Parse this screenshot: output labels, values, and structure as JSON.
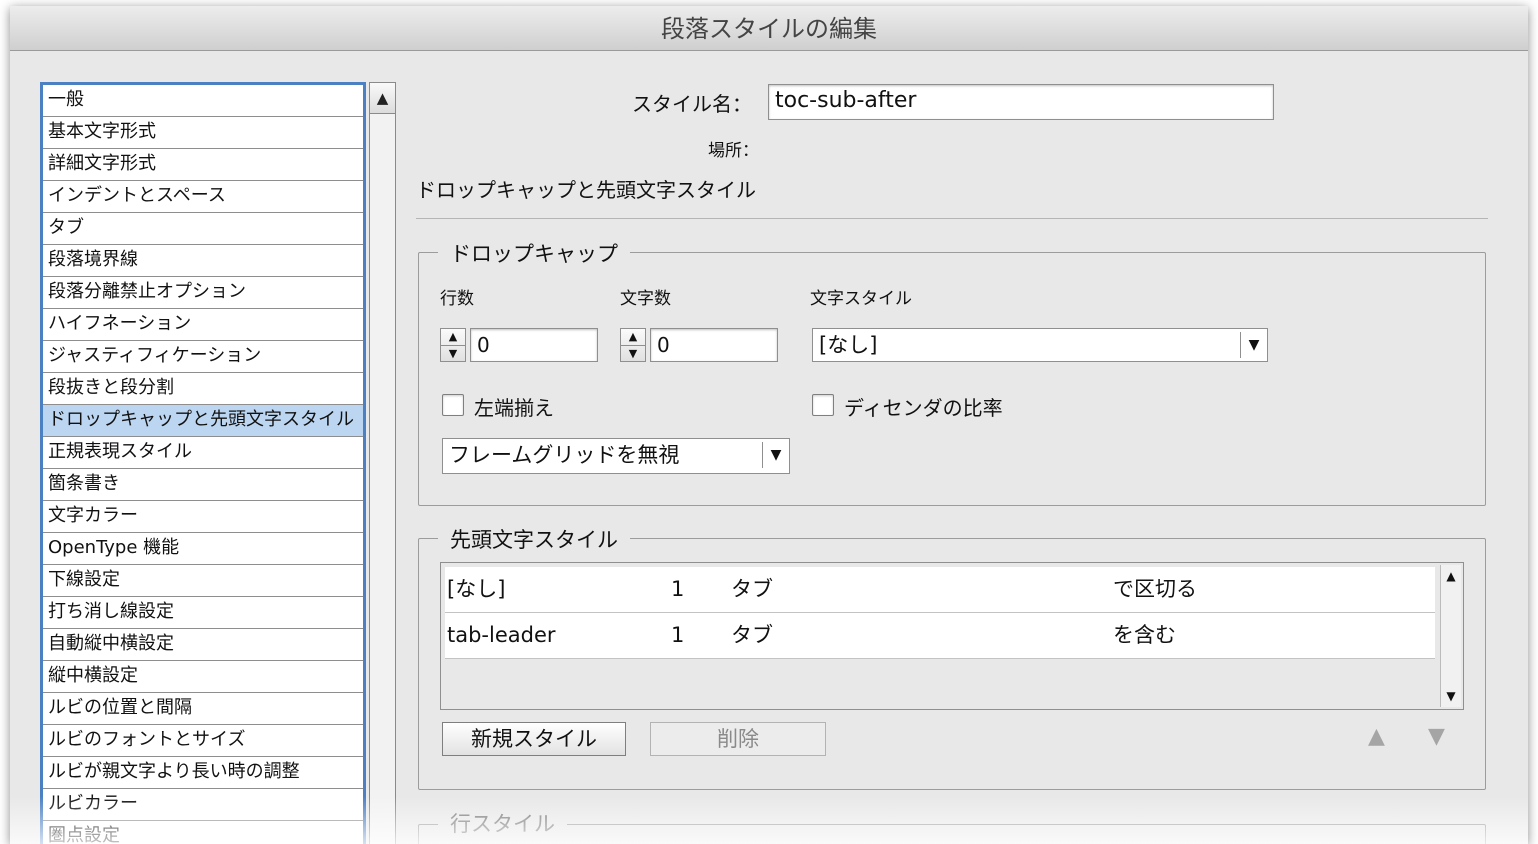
{
  "dialog": {
    "title": "段落スタイルの編集"
  },
  "sidebar": {
    "items": [
      "一般",
      "基本文字形式",
      "詳細文字形式",
      "インデントとスペース",
      "タブ",
      "段落境界線",
      "段落分離禁止オプション",
      "ハイフネーション",
      "ジャスティフィケーション",
      "段抜きと段分割",
      "ドロップキャップと先頭文字スタイル",
      "正規表現スタイル",
      "箇条書き",
      "文字カラー",
      "OpenType 機能",
      "下線設定",
      "打ち消し線設定",
      "自動縦中横設定",
      "縦中横設定",
      "ルビの位置と間隔",
      "ルビのフォントとサイズ",
      "ルビが親文字より長い時の調整",
      "ルビカラー",
      "圏点設定"
    ],
    "selected_index": 10
  },
  "header": {
    "style_name_label": "スタイル名：",
    "style_name_value": "toc-sub-after",
    "location_label": "場所：",
    "section_title": "ドロップキャップと先頭文字スタイル"
  },
  "drop_cap": {
    "group_title": "ドロップキャップ",
    "lines_label": "行数",
    "lines_value": "0",
    "chars_label": "文字数",
    "chars_value": "0",
    "char_style_label": "文字スタイル",
    "char_style_value": "[なし]",
    "align_left_label": "左端揃え",
    "align_left_checked": false,
    "descender_label": "ディセンダの比率",
    "descender_checked": false,
    "frame_grid_value": "フレームグリッドを無視"
  },
  "nested_styles": {
    "group_title": "先頭文字スタイル",
    "rows": [
      {
        "style": "[なし]",
        "count": "1",
        "delimiter": "タブ",
        "mode": "で区切る"
      },
      {
        "style": "tab-leader",
        "count": "1",
        "delimiter": "タブ",
        "mode": "を含む"
      }
    ],
    "new_style_label": "新規スタイル",
    "delete_label": "削除"
  },
  "line_styles": {
    "group_title": "行スタイル"
  }
}
